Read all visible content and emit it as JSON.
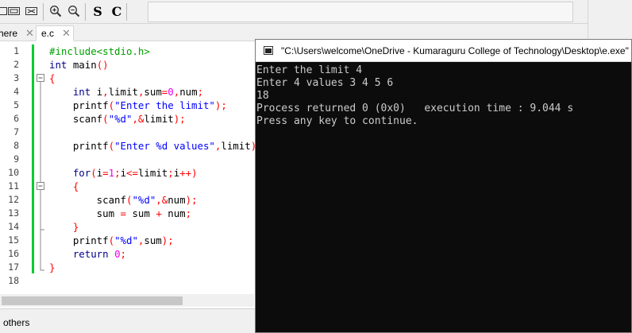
{
  "toolbar": {
    "icons": [
      "window-icon",
      "window-alt-icon",
      "zoom-in-icon",
      "zoom-out-icon",
      "match-case-s-icon",
      "match-case-c-icon"
    ],
    "s_label": "S",
    "c_label": "C"
  },
  "tabs": [
    {
      "label": "here",
      "close": "✕"
    },
    {
      "label": "e.c",
      "close": "✕"
    }
  ],
  "editor": {
    "line_numbers": [
      "1",
      "2",
      "3",
      "4",
      "5",
      "6",
      "7",
      "8",
      "9",
      "10",
      "11",
      "12",
      "13",
      "14",
      "15",
      "16",
      "17",
      "18"
    ]
  },
  "bottom": {
    "others_label": "others"
  },
  "console": {
    "title": "\"C:\\Users\\welcome\\OneDrive - Kumaraguru College of Technology\\Desktop\\e.exe\"",
    "lines": [
      "Enter the limit 4",
      "Enter 4 values 3 4 5 6",
      "18",
      "Process returned 0 (0x0)   execution time : 9.044 s",
      "Press any key to continue."
    ]
  },
  "colors": {
    "change_bar": "#00cc33",
    "keyword": "#00008b",
    "string": "#0000ff",
    "number": "#f000f0",
    "operator": "#ff0000",
    "preprocessor": "#00a000"
  }
}
